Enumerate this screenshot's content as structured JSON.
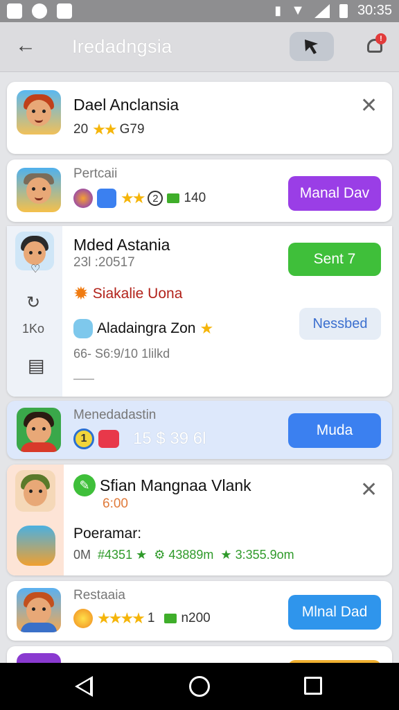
{
  "status": {
    "time": "30:35"
  },
  "appbar": {
    "title": "Iredadngsia"
  },
  "colors": {
    "accent_purple": "#9a3ee6",
    "accent_green": "#3fbf3a",
    "accent_blue": "#3b80f0",
    "highlight": "#dde8fb"
  },
  "cards": [
    {
      "title": "Dael Anclansia",
      "meta_prefix": "20",
      "stars": "★★",
      "meta_suffix": "G79"
    },
    {
      "subtitle": "Pertcaii",
      "rating_badge": "2",
      "count": "140",
      "button": "Manal Dav"
    },
    {
      "title": "Mded Astania",
      "date": "23l :20517",
      "side_label": "1Ko",
      "row1": "Siakalie Uona",
      "row2": "Aladaingra Zon",
      "row3": "66-  S6:9/10 1lilkd",
      "button": "Sent  7",
      "button2": "Nessbed"
    },
    {
      "subtitle": "Menedadastin",
      "badge": "1",
      "amount": "15 $ 39 6l",
      "button": "Muda"
    },
    {
      "title": "Sfian Mangnaa Vlank",
      "price": "6:00",
      "label": "Poeramar:",
      "stats": "0M",
      "stat1": "4351",
      "stat2": "43889m",
      "stat3": "3:355.9om"
    },
    {
      "subtitle": "Restaaia",
      "rating": "1",
      "count": "n200",
      "button": "Mlnal Dad"
    }
  ]
}
